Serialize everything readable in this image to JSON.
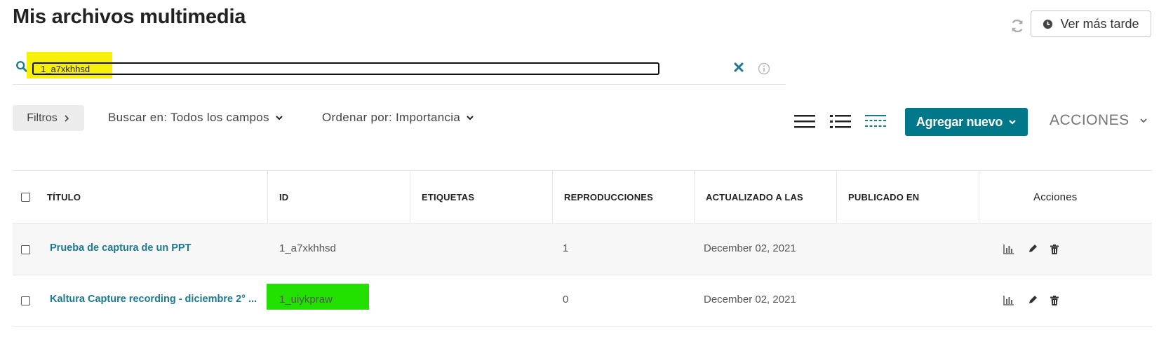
{
  "header": {
    "title": "Mis archivos multimedia",
    "watch_later_label": "Ver más tarde"
  },
  "search": {
    "value": "1_a7xkhhsd",
    "placeholder": ""
  },
  "toolbar": {
    "filters_label": "Filtros",
    "search_in_label": "Buscar en: Todos los campos",
    "sort_label": "Ordenar por: Importancia",
    "add_new_label": "Agregar nuevo",
    "actions_label": "ACCIONES"
  },
  "table": {
    "columns": [
      "TÍTULO",
      "ID",
      "ETIQUETAS",
      "REPRODUCCIONES",
      "ACTUALIZADO A LAS",
      "PUBLICADO EN",
      "Acciones"
    ],
    "rows": [
      {
        "title": "Prueba de captura de un PPT",
        "id": "1_a7xkhhsd",
        "tags": "",
        "plays": "1",
        "updated": "December 02, 2021",
        "published": ""
      },
      {
        "title": "Kaltura Capture recording - diciembre 2° ...",
        "id": "1_uiykpraw",
        "tags": "",
        "plays": "0",
        "updated": "December 02, 2021",
        "published": ""
      }
    ]
  },
  "colors": {
    "accent": "#00788a",
    "link": "#1b7a8e",
    "search_highlight": "#f7f00a",
    "id_highlight": "#22e000"
  },
  "icons": [
    "refresh-icon",
    "clock-icon",
    "search-icon",
    "clear-icon",
    "info-icon",
    "chevron-right-icon",
    "chevron-down-icon",
    "view-list-icon",
    "view-detailed-icon",
    "view-table-icon",
    "analytics-icon",
    "edit-icon",
    "delete-icon"
  ]
}
